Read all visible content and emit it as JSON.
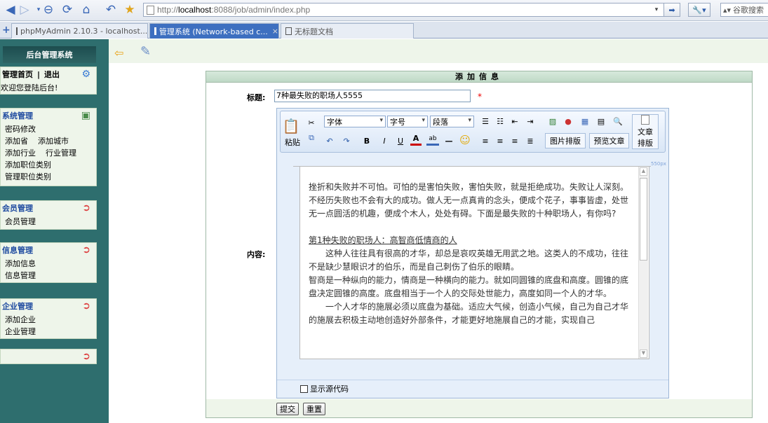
{
  "browser": {
    "url_prefix": "http://",
    "url_host": "localhost",
    "url_rest": ":8088/job/admin/index.php",
    "search_placeholder": "谷歌搜索"
  },
  "tabs": [
    {
      "label": "phpMyAdmin 2.10.3 - localhost..."
    },
    {
      "label": "管理系统 (Network-based c...",
      "close": "×"
    },
    {
      "label": "无标题文档"
    }
  ],
  "sidebar": {
    "title": "后台管理系统",
    "top_panel": {
      "home_label": "管理首页",
      "separator": "|",
      "logout_label": "退出",
      "welcome": "欢迎您登陆后台!"
    },
    "panels": [
      {
        "title": "系统管理",
        "items": [
          [
            "密码修改"
          ],
          [
            "添加省",
            "添加城市"
          ],
          [
            "添加行业",
            "行业管理"
          ],
          [
            "添加职位类别"
          ],
          [
            "管理职位类别"
          ]
        ]
      },
      {
        "title": "会员管理",
        "items": [
          [
            "会员管理"
          ]
        ]
      },
      {
        "title": "信息管理",
        "items": [
          [
            "添加信息"
          ],
          [
            "信息管理"
          ]
        ]
      },
      {
        "title": "企业管理",
        "items": [
          [
            "添加企业"
          ],
          [
            "企业管理"
          ]
        ]
      },
      {
        "title": "",
        "items": []
      }
    ]
  },
  "form": {
    "heading": "添加信息",
    "title_label": "标题:",
    "title_value": "7种最失败的职场人5555",
    "required_mark": "*",
    "content_label": "内容:",
    "submit_label": "提交",
    "reset_label": "重置"
  },
  "editor": {
    "paste_label": "粘贴",
    "font_select": "字体",
    "size_select": "字号",
    "paragraph_select": "段落",
    "image_layout_btn": "图片排版",
    "preview_btn": "预览文章",
    "article_layout_line1": "文章",
    "article_layout_line2": "排版",
    "ruler_label": "550px",
    "show_source_label": "显示源代码",
    "content": {
      "p1": "挫折和失败并不可怕。可怕的是害怕失败，害怕失败，就是拒绝成功。失败让人深刻。不经历失败也不会有大的成功。做人无一点真肯的念头，便成个花子，事事皆虚，处世无一点圆活的机趣，便成个木人，处处有碍。下面是最失败的十种职场人，有你吗?",
      "h1": "第1种失败的职场人：高智商低情商的人",
      "p2": "　　这种人往往具有很高的才华，却总是哀叹英雄无用武之地。这类人的不成功，往往不是缺少慧眼识才的伯乐，而是自己刺伤了伯乐的眼睛。",
      "p3": "智商是一种纵向的能力，情商是一种横向的能力。就如同圆锥的底盘和高度。圆锥的底盘决定圆锥的高度。底盘相当于一个人的交际处世能力，高度如同一个人的才华。",
      "p4": "　　一个人才华的施展必须以底盘为基础。适应大气候，创造小气候，自己为自己才华的施展去积极主动地创造好外部条件，才能更好地施展自己的才能，实现自己"
    }
  }
}
